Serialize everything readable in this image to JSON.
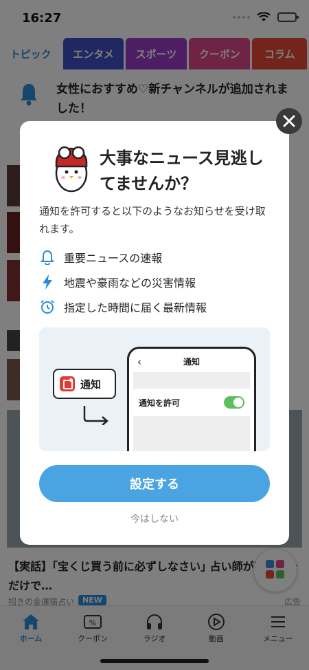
{
  "status_bar": {
    "time": "16:27"
  },
  "tabs": [
    {
      "label": "トピック",
      "color": "#ffffff",
      "width": 92
    },
    {
      "label": "エンタメ",
      "color": "#3f51c4",
      "width": 90
    },
    {
      "label": "スポーツ",
      "color": "#9c3cc8",
      "width": 92
    },
    {
      "label": "クーポン",
      "color": "#e0488a",
      "width": 92
    },
    {
      "label": "コラム",
      "color": "#e64a3b",
      "width": 82
    }
  ],
  "notice": {
    "text": "女性におすすめ♡新チャンネルが追加されました！"
  },
  "article": {
    "headline": "【実話】｢宝くじ買う前に必ずしなさい｣ 占い師が感動しただけで…",
    "source": "招きの金運猫占い",
    "ad_label": "広告"
  },
  "bottom_nav": {
    "items": [
      {
        "label": "ホーム",
        "icon": "home-icon"
      },
      {
        "label": "クーポン",
        "icon": "coupon-icon",
        "badge": "NEW"
      },
      {
        "label": "ラジオ",
        "icon": "headphones-icon"
      },
      {
        "label": "動画",
        "icon": "play-icon"
      },
      {
        "label": "メニュー",
        "icon": "menu-icon"
      }
    ]
  },
  "modal": {
    "title": "大事なニュース見逃してませんか？",
    "description": "通知を許可すると以下のようなお知らせを受け取れます。",
    "features": [
      {
        "icon": "bell-icon",
        "label": "重要ニュースの速報"
      },
      {
        "icon": "lightning-icon",
        "label": "地震や豪雨などの災害情報"
      },
      {
        "icon": "alarm-clock-icon",
        "label": "指定した時間に届く最新情報"
      }
    ],
    "illustration": {
      "notif_label": "通知",
      "phone_title": "通知",
      "phone_back": "‹",
      "row_label": "通知を許可"
    },
    "cta_label": "設定する",
    "dismiss_label": "今はしない"
  },
  "colors": {
    "accent": "#4aa4e2",
    "tab_active_text": "#2a8cd8",
    "toggle_on": "#5cbf5c"
  }
}
